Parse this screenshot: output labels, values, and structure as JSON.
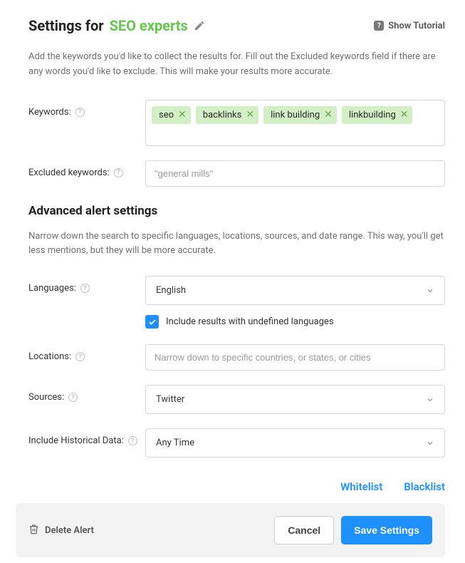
{
  "header": {
    "title_prefix": "Settings for",
    "title_name": "SEO experts",
    "tutorial_label": "Show Tutorial"
  },
  "intro": "Add the keywords you'd like to collect the results for. Fill out the Excluded keywords field if there are any words you'd like to exclude. This will make your results more accurate.",
  "fields": {
    "keywords_label": "Keywords:",
    "keywords": [
      "seo",
      "backlinks",
      "link building",
      "linkbuilding"
    ],
    "excluded_label": "Excluded keywords:",
    "excluded_placeholder": "\"general mills\""
  },
  "advanced": {
    "title": "Advanced alert settings",
    "desc": "Narrow down the search to specific languages, locations, sources, and date range. This way, you'll get less mentions, but they will be more accurate.",
    "languages_label": "Languages:",
    "languages_value": "English",
    "include_undefined_label": "Include results with undefined languages",
    "include_undefined_checked": true,
    "locations_label": "Locations:",
    "locations_placeholder": "Narrow down to specific countries, or states, or cities",
    "sources_label": "Sources:",
    "sources_value": "Twitter",
    "historical_label": "Include Historical Data:",
    "historical_value": "Any Time"
  },
  "links": {
    "whitelist": "Whitelist",
    "blacklist": "Blacklist"
  },
  "footer": {
    "delete_label": "Delete Alert",
    "cancel_label": "Cancel",
    "save_label": "Save Settings"
  }
}
